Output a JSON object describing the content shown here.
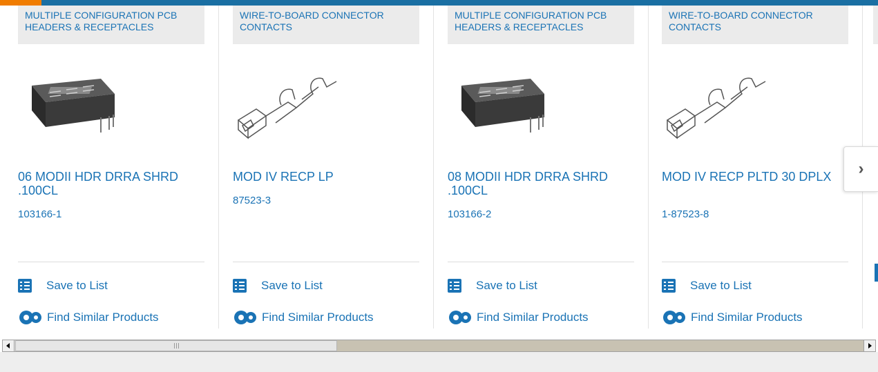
{
  "colors": {
    "accent_blue": "#1a73b5",
    "top_bar": "#1a6fa3",
    "top_bar_accent": "#f07c00"
  },
  "cards": [
    {
      "category": "MULTIPLE CONFIGURATION PCB HEADERS & RECEPTACLES",
      "name": "06 MODII HDR DRRA SHRD .100CL",
      "part_number": "103166-1",
      "image": "pcb-header-image",
      "save_label": "Save to List",
      "similar_label": "Find Similar Products"
    },
    {
      "category": "WIRE-TO-BOARD CONNECTOR CONTACTS",
      "name": "MOD IV RECP LP",
      "part_number": "87523-3",
      "image": "crimp-contact-image",
      "save_label": "Save to List",
      "similar_label": "Find Similar Products"
    },
    {
      "category": "MULTIPLE CONFIGURATION PCB HEADERS & RECEPTACLES",
      "name": "08 MODII HDR DRRA SHRD .100CL",
      "part_number": "103166-2",
      "image": "pcb-header-image",
      "save_label": "Save to List",
      "similar_label": "Find Similar Products"
    },
    {
      "category": "WIRE-TO-BOARD CONNECTOR CONTACTS",
      "name": "MOD IV RECP PLTD 30 DPLX",
      "part_number": "1-87523-8",
      "image": "crimp-contact-image",
      "save_label": "Save to List",
      "similar_label": "Find Similar Products"
    }
  ],
  "navigation": {
    "next_icon": "chevron-right-icon"
  },
  "scrollbar": {
    "left_icon": "scroll-left-arrow-icon",
    "right_icon": "scroll-right-arrow-icon"
  }
}
